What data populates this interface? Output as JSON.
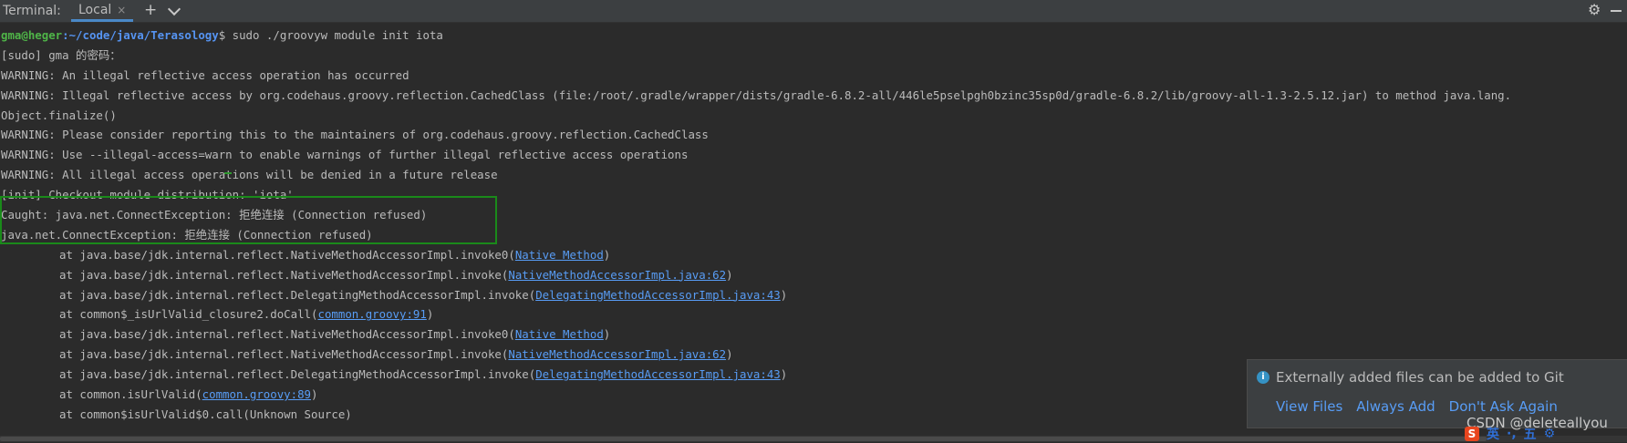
{
  "tabbar": {
    "terminal_label": "Terminal:",
    "tab_local": "Local",
    "tab_close": "×",
    "add": "+",
    "settings_icon": "⚙"
  },
  "console": {
    "prompt": {
      "user": "gma@heger",
      "path": ":~/code/java/Terasology",
      "command": "$ sudo ./groovyw module init iota"
    },
    "lines": [
      "[sudo] gma 的密码：",
      "WARNING: An illegal reflective access operation has occurred",
      "WARNING: Illegal reflective access by org.codehaus.groovy.reflection.CachedClass (file:/root/.gradle/wrapper/dists/gradle-6.8.2-all/446le5pselpgh0bzinc35sp0d/gradle-6.8.2/lib/groovy-all-1.3-2.5.12.jar) to method java.lang.",
      "Object.finalize()",
      "WARNING: Please consider reporting this to the maintainers of org.codehaus.groovy.reflection.CachedClass",
      "WARNING: Use --illegal-access=warn to enable warnings of further illegal reflective access operations",
      "WARNING: All illegal access operations will be denied in a future release",
      "[init] Checkout module distribution: 'iota'",
      "Caught: java.net.ConnectException: 拒绝连接 (Connection refused)",
      "java.net.ConnectException: 拒绝连接 (Connection refused)"
    ],
    "stack": [
      {
        "pre": "at java.base/jdk.internal.reflect.NativeMethodAccessorImpl.invoke0(",
        "link": "Native Method",
        "post": ")"
      },
      {
        "pre": "at java.base/jdk.internal.reflect.NativeMethodAccessorImpl.invoke(",
        "link": "NativeMethodAccessorImpl.java:62",
        "post": ")"
      },
      {
        "pre": "at java.base/jdk.internal.reflect.DelegatingMethodAccessorImpl.invoke(",
        "link": "DelegatingMethodAccessorImpl.java:43",
        "post": ")"
      },
      {
        "pre": "at common$_isUrlValid_closure2.doCall(",
        "link": "common.groovy:91",
        "post": ")"
      },
      {
        "pre": "at java.base/jdk.internal.reflect.NativeMethodAccessorImpl.invoke0(",
        "link": "Native Method",
        "post": ")"
      },
      {
        "pre": "at java.base/jdk.internal.reflect.NativeMethodAccessorImpl.invoke(",
        "link": "NativeMethodAccessorImpl.java:62",
        "post": ")"
      },
      {
        "pre": "at java.base/jdk.internal.reflect.DelegatingMethodAccessorImpl.invoke(",
        "link": "DelegatingMethodAccessorImpl.java:43",
        "post": ")"
      },
      {
        "pre": "at common.isUrlValid(",
        "link": "common.groovy:89",
        "post": ")"
      },
      {
        "pre": "at common$isUrlValid$0.call(Unknown Source)",
        "link": "",
        "post": ""
      }
    ]
  },
  "notification": {
    "icon": "i",
    "message": "Externally added files can be added to Git",
    "actions": [
      "View Files",
      "Always Add",
      "Don't Ask Again"
    ]
  },
  "watermark": "CSDN @deleteallyou",
  "ime": {
    "logo": "S",
    "lang": "英",
    "punct": "·,",
    "mode": "五",
    "gear": "⚙"
  }
}
